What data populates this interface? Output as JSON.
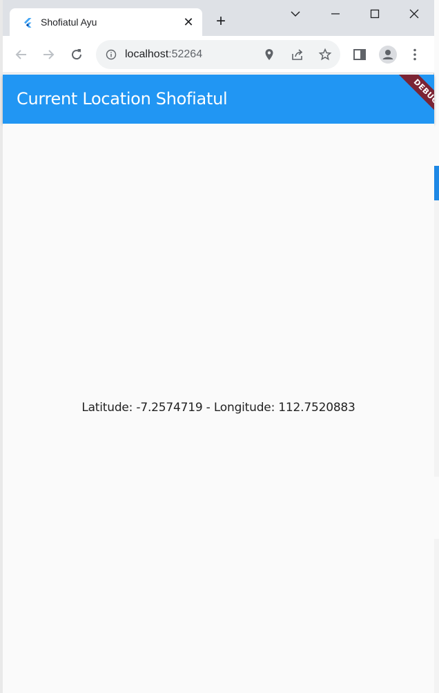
{
  "browser": {
    "tab": {
      "title": "Shofiatul Ayu",
      "favicon": "flutter-icon",
      "close_glyph": "✕"
    },
    "new_tab_glyph": "+",
    "address": {
      "host": "localhost",
      "port": ":52264"
    }
  },
  "app": {
    "appbar": {
      "title": "Current Location Shofiatul",
      "color": "#2196f3"
    },
    "debug_banner": "DEBUG",
    "location_text": "Latitude: -7.2574719 - Longitude: 112.7520883"
  }
}
